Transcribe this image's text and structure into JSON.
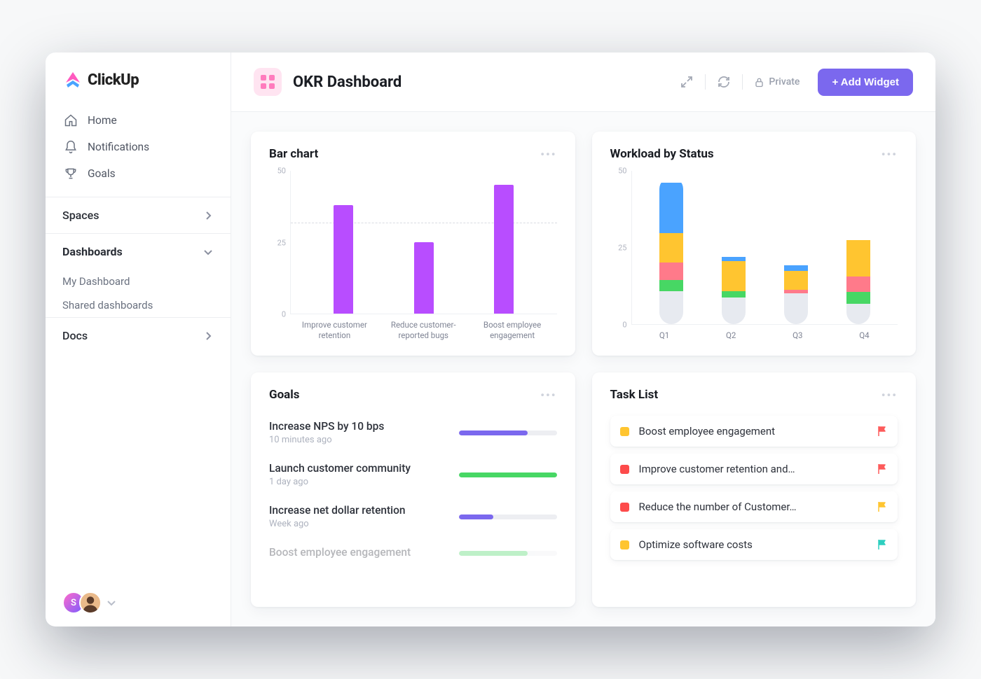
{
  "brand": "ClickUp",
  "sidebar": {
    "items": [
      {
        "icon": "home-icon",
        "label": "Home"
      },
      {
        "icon": "bell-icon",
        "label": "Notifications"
      },
      {
        "icon": "trophy-icon",
        "label": "Goals"
      }
    ],
    "sections": [
      {
        "label": "Spaces",
        "expanded": false,
        "children": []
      },
      {
        "label": "Dashboards",
        "expanded": true,
        "children": [
          "My Dashboard",
          "Shared dashboards"
        ]
      },
      {
        "label": "Docs",
        "expanded": false,
        "children": []
      }
    ],
    "avatars": [
      "S"
    ]
  },
  "header": {
    "title": "OKR Dashboard",
    "privacy_label": "Private",
    "add_widget_label": "+ Add Widget"
  },
  "widgets": {
    "barchart": {
      "title": "Bar chart",
      "ymax": 50,
      "ticks": [
        0,
        25,
        50
      ],
      "reference_line": 32
    },
    "workload": {
      "title": "Workload by Status",
      "ymax": 50,
      "ticks": [
        0,
        25,
        50
      ]
    },
    "goals": {
      "title": "Goals",
      "items": [
        {
          "name": "Increase NPS by 10 bps",
          "time": "10 minutes ago",
          "pct": 70,
          "color": "purple"
        },
        {
          "name": "Launch customer community",
          "time": "1 day ago",
          "pct": 100,
          "color": "green"
        },
        {
          "name": "Increase net dollar retention",
          "time": "Week ago",
          "pct": 35,
          "color": "purple"
        },
        {
          "name": "Boost employee engagement",
          "time": "",
          "pct": 70,
          "color": "green",
          "faded": true
        }
      ]
    },
    "tasks": {
      "title": "Task List",
      "items": [
        {
          "status": "yellow",
          "name": "Boost employee engagement",
          "flag": "red"
        },
        {
          "status": "red",
          "name": "Improve customer retention and…",
          "flag": "red"
        },
        {
          "status": "red",
          "name": "Reduce the number of Customer…",
          "flag": "yellow"
        },
        {
          "status": "yellow",
          "name": "Optimize software costs",
          "flag": "teal"
        }
      ]
    }
  },
  "chart_data": [
    {
      "type": "bar",
      "title": "Bar chart",
      "categories": [
        "Improve customer retention",
        "Reduce customer-reported bugs",
        "Boost employee engagement"
      ],
      "values": [
        38,
        25,
        45
      ],
      "ylim": [
        0,
        50
      ],
      "reference_line": 32
    },
    {
      "type": "bar",
      "title": "Workload by Status",
      "stacked": true,
      "categories": [
        "Q1",
        "Q2",
        "Q3",
        "Q4"
      ],
      "series": [
        {
          "name": "grey",
          "values": [
            11,
            13,
            16,
            9
          ]
        },
        {
          "name": "green",
          "values": [
            4,
            3,
            0,
            5
          ]
        },
        {
          "name": "pink",
          "values": [
            6,
            0,
            2,
            7
          ]
        },
        {
          "name": "yellow",
          "values": [
            10,
            15,
            10,
            16
          ]
        },
        {
          "name": "blue",
          "values": [
            17,
            2,
            3,
            0
          ]
        }
      ],
      "ylim": [
        0,
        50
      ]
    }
  ]
}
